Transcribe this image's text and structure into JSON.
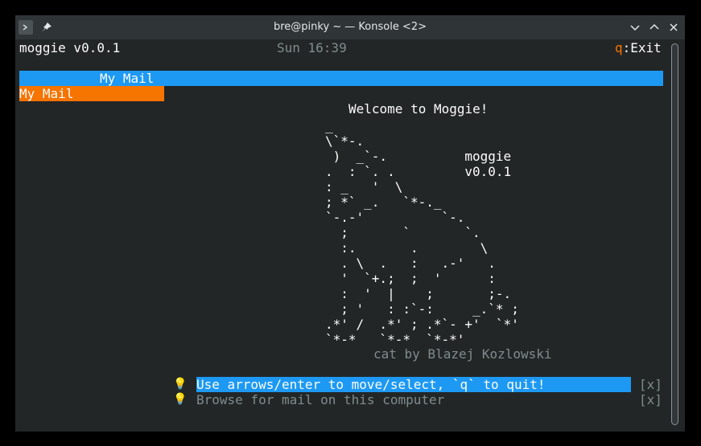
{
  "window": {
    "title": "bre@pinky ~ — Konsole <2>",
    "icons": [
      "terminal-app-icon",
      "pin-icon",
      "chevron-down-icon",
      "chevron-up-icon",
      "close-icon"
    ]
  },
  "status": {
    "app_name": "moggie v0.0.1",
    "clock": "Sun 16:39",
    "exit_key": "q",
    "exit_label": ":Exit"
  },
  "pane": {
    "header": "My Mail"
  },
  "sidebar": {
    "items": [
      "My Mail"
    ]
  },
  "welcome": {
    "title": "Welcome to Moggie!",
    "art_lines": [
      "_",
      "\\`*-.",
      " )  _`-.          moggie",
      ".  : `. .         v0.0.1",
      ": _   '  \\",
      "; *` _.   `*-._",
      "`-.-'          `-.",
      "  ;       `       `.",
      "  :.       .        \\",
      "  . \\  .   :   .-'   .",
      "  '  `+.;  ;  '      :",
      "  :  '  |    ;       ;-.",
      "  ; '   : :`-:     _.`* ;",
      ".*' /  .*' ; .*`- +'  `*'",
      "`*-*   `*-*  `*-*'"
    ],
    "credit": "cat by Blazej Kozlowski"
  },
  "hints": [
    {
      "icon": "lightbulb-icon",
      "text": "Use arrows/enter to move/select, `q` to quit!",
      "dismiss": "[x]"
    },
    {
      "icon": "lightbulb-icon",
      "text": "Browse for mail on this computer",
      "dismiss": "[x]"
    }
  ],
  "colors": {
    "accent_blue": "#1d99f3",
    "selection_orange": "#f67400",
    "hint_gray": "#7f8c8d",
    "background": "#232627"
  }
}
